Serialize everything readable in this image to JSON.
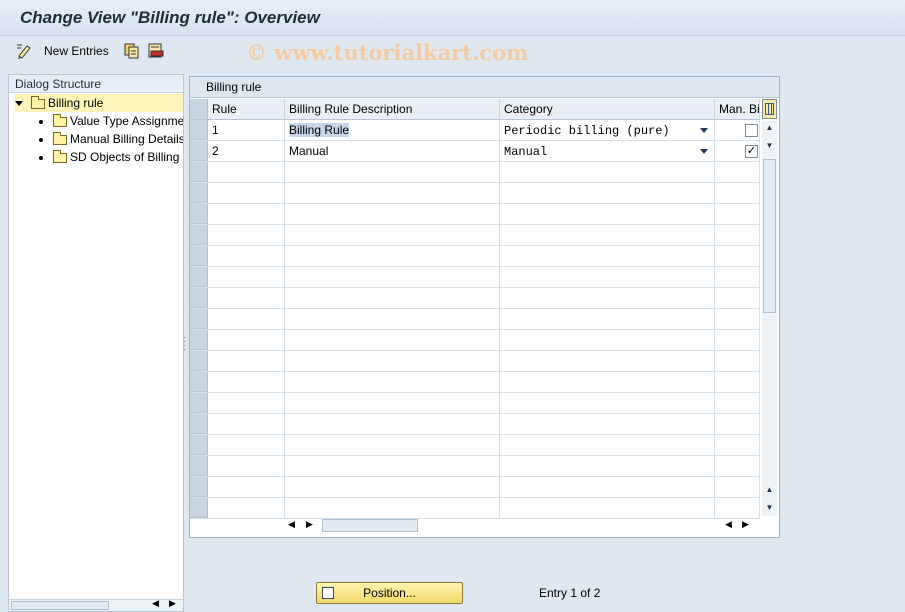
{
  "window": {
    "title": "Change View \"Billing rule\": Overview"
  },
  "toolbar": {
    "new_entries_label": "New Entries",
    "icons": [
      "pen-icon",
      "copy-icon",
      "delete-icon"
    ]
  },
  "watermark": "© www.tutorialkart.com",
  "dialog_structure": {
    "header": "Dialog Structure",
    "root": "Billing rule",
    "children": [
      "Value Type Assignme",
      "Manual Billing Details",
      "SD Objects of Billing"
    ]
  },
  "table": {
    "caption": "Billing rule",
    "columns": [
      "Rule",
      "Billing Rule Description",
      "Category",
      "Man. Bil"
    ],
    "rows": [
      {
        "rule": "1",
        "description": "Billing Rule",
        "category": "Periodic billing (pure)",
        "manual": false
      },
      {
        "rule": "2",
        "description": "Manual",
        "category": "Manual",
        "manual": true
      }
    ],
    "empty_rows": 17
  },
  "footer": {
    "position_button": "Position...",
    "entry_text": "Entry 1 of 2"
  },
  "colors": {
    "background": "#dfe8f1",
    "selected_row": "#fff5b8",
    "button_yellow": "#f2d86a"
  }
}
